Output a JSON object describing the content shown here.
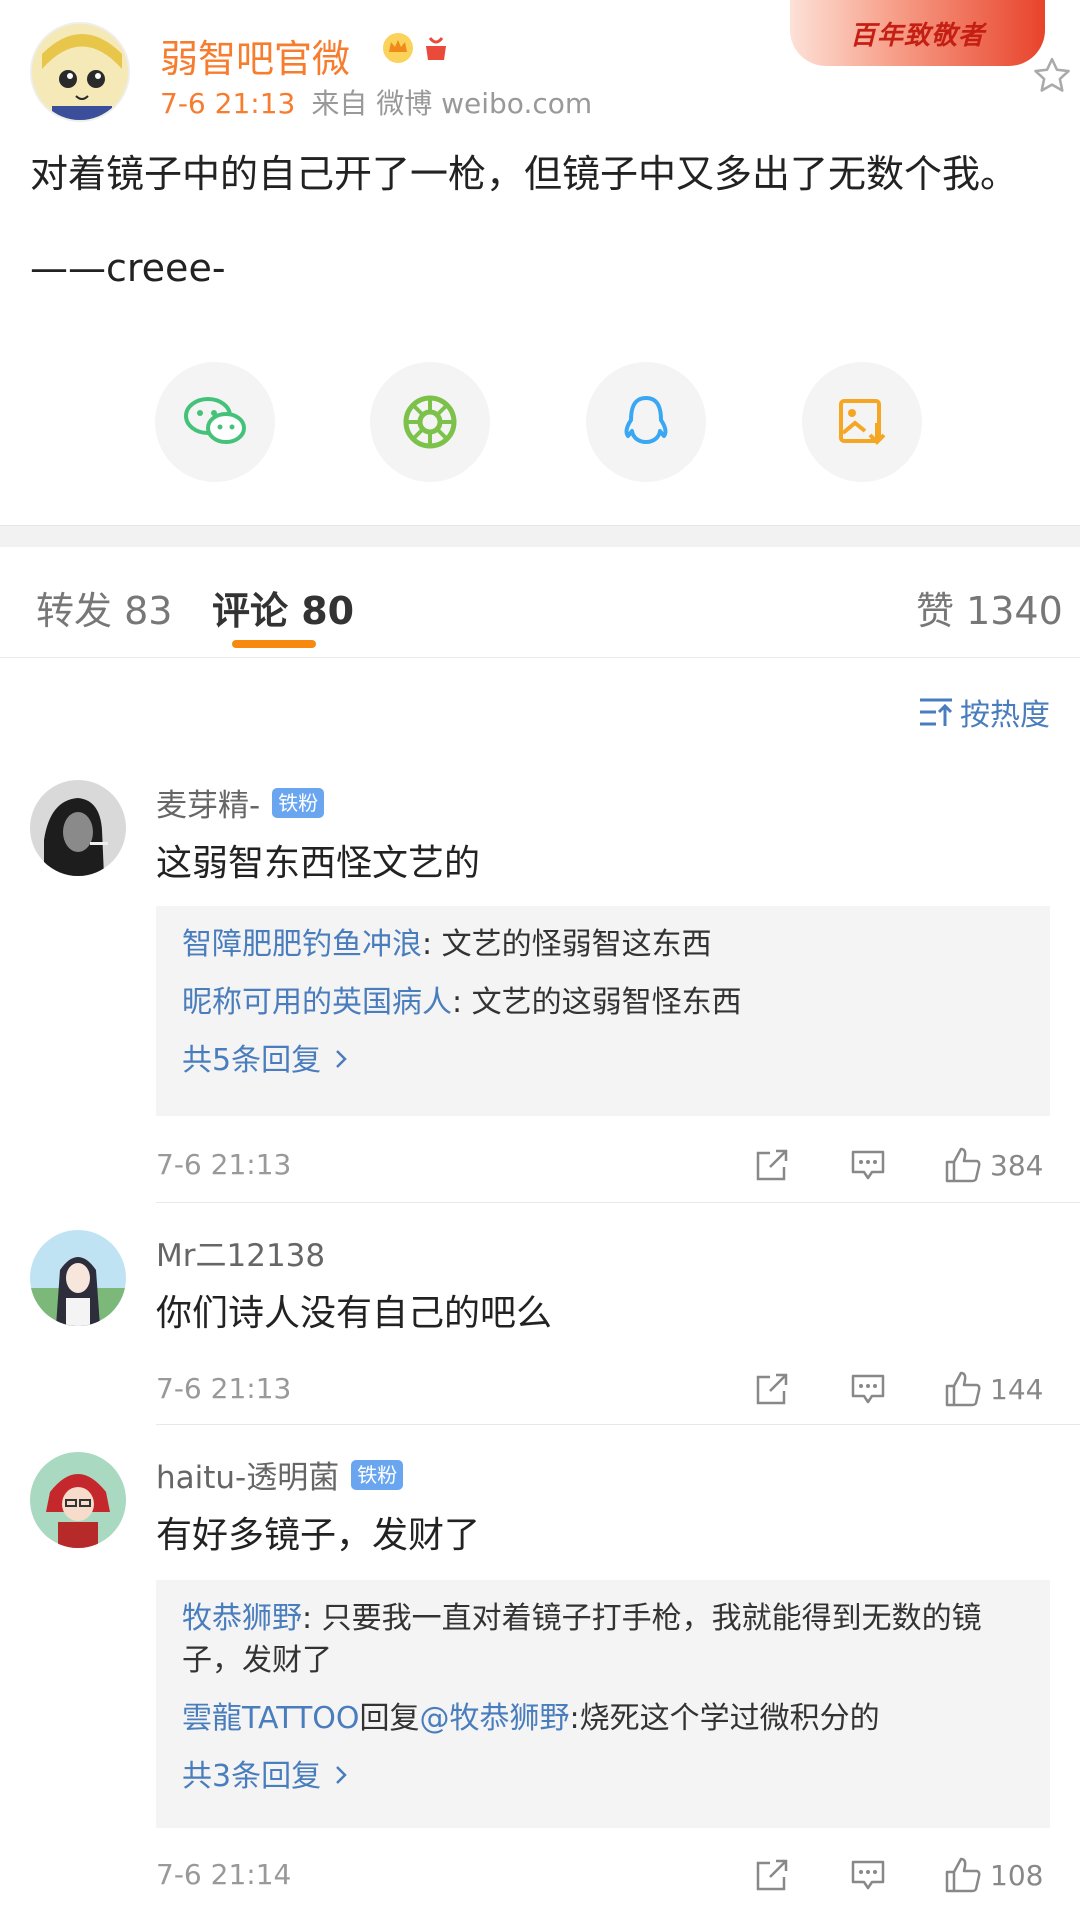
{
  "post": {
    "author": "弱智吧官微",
    "time": "7-6 21:13",
    "source": "来自 微博 weibo.com",
    "banner_text": "百年致敬者",
    "text": "对着镜子中的自己开了一枪，但镜子中又多出了无数个我。",
    "signature": "——creee-"
  },
  "share": [
    {
      "name": "wechat",
      "icon": "wechat-icon",
      "color": "#45c27a"
    },
    {
      "name": "moments",
      "icon": "moments-icon",
      "color": "#7cc24a"
    },
    {
      "name": "qq",
      "icon": "qq-icon",
      "color": "#3aa7f2"
    },
    {
      "name": "save-image",
      "icon": "save-image-icon",
      "color": "#f5a623"
    }
  ],
  "tabs": {
    "repost": "转发 83",
    "comments": "评论 80",
    "likes": "赞 1340"
  },
  "sort_label": "按热度",
  "comments": [
    {
      "user": "麦芽精-",
      "badge": "铁粉",
      "text": "这弱智东西怪文艺的",
      "replies": [
        {
          "user": "智障肥肥钓鱼冲浪",
          "text": ": 文艺的怪弱智这东西"
        },
        {
          "user": "昵称可用的英国病人",
          "text": ": 文艺的这弱智怪东西"
        }
      ],
      "more": "共5条回复",
      "time": "7-6 21:13",
      "likes": "384"
    },
    {
      "user": "Mr二12138",
      "text": "你们诗人没有自己的吧么",
      "time": "7-6 21:13",
      "likes": "144"
    },
    {
      "user": "haitu-透明菌",
      "badge": "铁粉",
      "text": "有好多镜子，发财了",
      "replies": [
        {
          "user": "牧恭狮野",
          "text": ": 只要我一直对着镜子打手枪，我就能得到无数的镜子，发财了"
        },
        {
          "user": "雲龍TATTOO",
          "mid": "回复",
          "user2": "@牧恭狮野",
          "text": ":烧死这个学过微积分的"
        }
      ],
      "more": "共3条回复",
      "time": "7-6 21:14",
      "likes": "108"
    }
  ],
  "colors": {
    "accent": "#f7890f",
    "link": "#4a7dbd",
    "name_orange": "#f77c2e"
  }
}
